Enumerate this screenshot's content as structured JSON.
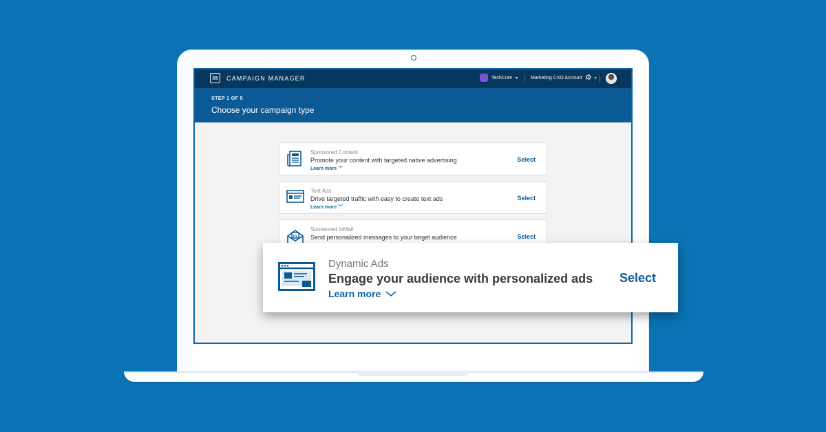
{
  "app": {
    "title": "CAMPAIGN MANAGER",
    "logo_text": "in"
  },
  "topbar": {
    "organization": "TechCore",
    "account": "Marketing CXO Account",
    "caret": "▾"
  },
  "header": {
    "step": "STEP 1 OF 5",
    "title": "Choose your campaign type"
  },
  "cards": [
    {
      "category": "Sponsored Content",
      "description": "Promote your content with targeted native advertising",
      "learn_more": "Learn more",
      "select": "Select",
      "icon": "newspaper-icon"
    },
    {
      "category": "Text Ads",
      "description": "Drive targeted traffic with easy to create text ads",
      "learn_more": "Learn more",
      "select": "Select",
      "icon": "text-ad-icon"
    },
    {
      "category": "Sponsored InMail",
      "description": "Send personalized messages to your target audience",
      "learn_more": "Learn more",
      "select": "Select",
      "icon": "envelope-icon"
    }
  ],
  "featured": {
    "category": "Dynamic Ads",
    "description": "Engage your audience with personalized ads",
    "learn_more": "Learn more",
    "select": "Select",
    "icon": "browser-window-icon"
  },
  "colors": {
    "background": "#0a73b5",
    "topbar": "#08375e",
    "header": "#0b5a95",
    "link": "#0b65a8"
  }
}
